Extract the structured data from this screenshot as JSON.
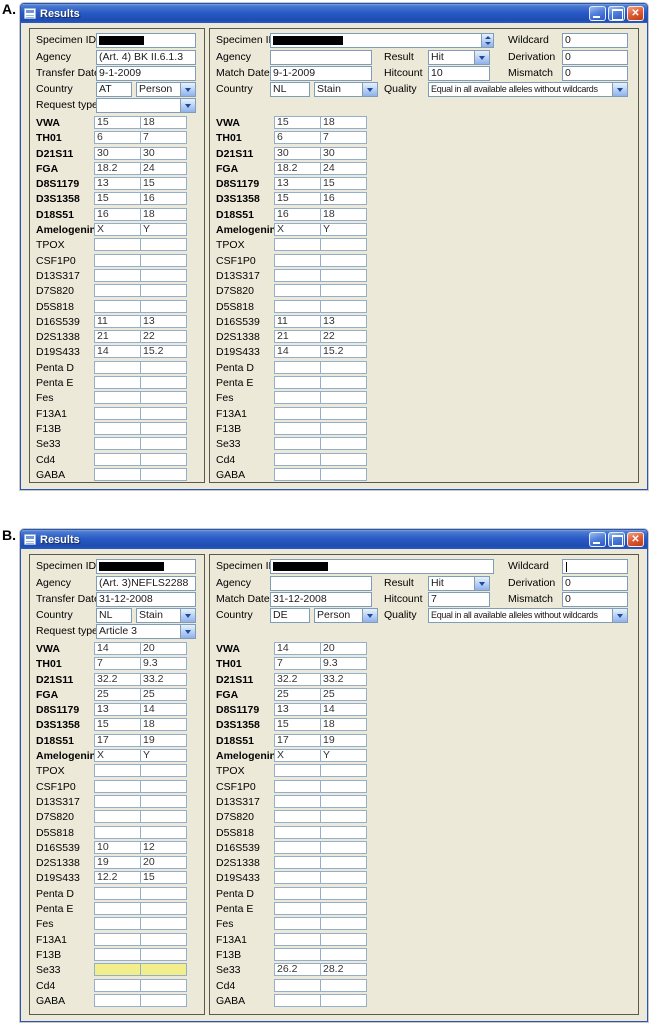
{
  "figure_labels": {
    "a": "A.",
    "b": "B."
  },
  "colors": {
    "titlebar_blue_top": "#7ba2e0",
    "titlebar_blue": "#2a5ac6",
    "title_text": "#ffffff",
    "window_bg": "#ece9d8",
    "groupbox_border": "#5a5a4c",
    "input_border": "#7f9db9",
    "loci_cell_border": "#94aecc",
    "highlight_yellow": "#f2ee8c",
    "close_button_red": "#e06038"
  },
  "icons": [
    "form-icon",
    "minimize-icon",
    "maximize-icon",
    "close-icon",
    "dropdown-arrow-icon",
    "spinner-up-down-icon"
  ],
  "loci": {
    "bold_count": 8,
    "names": [
      "VWA",
      "TH01",
      "D21S11",
      "FGA",
      "D8S1179",
      "D3S1358",
      "D18S51",
      "Amelogenin",
      "TPOX",
      "CSF1P0",
      "D13S317",
      "D7S820",
      "D5S818",
      "D16S539",
      "D2S1338",
      "D19S433",
      "Penta D",
      "Penta E",
      "Fes",
      "F13A1",
      "F13B",
      "Se33",
      "Cd4",
      "GABA"
    ]
  },
  "windows": [
    {
      "outer_label": "A.",
      "title": "Results",
      "left": {
        "labels": {
          "specimen": "Specimen ID",
          "agency": "Agency",
          "date": "Transfer Date",
          "country": "Country",
          "request": "Request type"
        },
        "specimen_redacted_width": 45,
        "agency": "(Art. 4) BK II.6.1.3",
        "date": "9-1-2009",
        "country_code": "AT",
        "country_type": "Person",
        "request_type": "",
        "highlighted_locus": "",
        "loci": [
          [
            "15",
            "18"
          ],
          [
            "6",
            "7"
          ],
          [
            "30",
            "30"
          ],
          [
            "18.2",
            "24"
          ],
          [
            "13",
            "15"
          ],
          [
            "15",
            "16"
          ],
          [
            "16",
            "18"
          ],
          [
            "X",
            "Y"
          ],
          [
            "",
            ""
          ],
          [
            "",
            ""
          ],
          [
            "",
            ""
          ],
          [
            "",
            ""
          ],
          [
            "",
            ""
          ],
          [
            "11",
            "13"
          ],
          [
            "21",
            "22"
          ],
          [
            "14",
            "15.2"
          ],
          [
            "",
            ""
          ],
          [
            "",
            ""
          ],
          [
            "",
            ""
          ],
          [
            "",
            ""
          ],
          [
            "",
            ""
          ],
          [
            "",
            ""
          ],
          [
            "",
            ""
          ],
          [
            "",
            ""
          ]
        ]
      },
      "right": {
        "labels": {
          "specimen": "Specimen ID",
          "agency": "Agency",
          "date": "Match Date",
          "country": "Country",
          "result": "Result",
          "hitcount": "Hitcount",
          "quality": "Quality",
          "wildcard": "Wildcard",
          "derivation": "Derivation",
          "mismatch": "Mismatch"
        },
        "specimen_redacted_width": 70,
        "specimen_has_spinner": true,
        "agency": "",
        "date": "9-1-2009",
        "country_code": "NL",
        "country_type": "Stain",
        "result": "Hit",
        "hitcount": "10",
        "quality": "Equal in all available alleles without wildcards",
        "wildcard": "0",
        "wildcard_caret": false,
        "derivation": "0",
        "mismatch": "0",
        "highlighted_locus": "",
        "loci": [
          [
            "15",
            "18"
          ],
          [
            "6",
            "7"
          ],
          [
            "30",
            "30"
          ],
          [
            "18.2",
            "24"
          ],
          [
            "13",
            "15"
          ],
          [
            "15",
            "16"
          ],
          [
            "16",
            "18"
          ],
          [
            "X",
            "Y"
          ],
          [
            "",
            ""
          ],
          [
            "",
            ""
          ],
          [
            "",
            ""
          ],
          [
            "",
            ""
          ],
          [
            "",
            ""
          ],
          [
            "11",
            "13"
          ],
          [
            "21",
            "22"
          ],
          [
            "14",
            "15.2"
          ],
          [
            "",
            ""
          ],
          [
            "",
            ""
          ],
          [
            "",
            ""
          ],
          [
            "",
            ""
          ],
          [
            "",
            ""
          ],
          [
            "",
            ""
          ],
          [
            "",
            ""
          ],
          [
            "",
            ""
          ]
        ]
      }
    },
    {
      "outer_label": "B.",
      "title": "Results",
      "left": {
        "labels": {
          "specimen": "Specimen ID",
          "agency": "Agency",
          "date": "Transfer Date",
          "country": "Country",
          "request": "Request type"
        },
        "specimen_redacted_width": 65,
        "agency": "(Art. 3)NEFLS2288",
        "date": "31-12-2008",
        "country_code": "NL",
        "country_type": "Stain",
        "request_type": "Article 3",
        "highlighted_locus": "Se33",
        "loci": [
          [
            "14",
            "20"
          ],
          [
            "7",
            "9.3"
          ],
          [
            "32.2",
            "33.2"
          ],
          [
            "25",
            "25"
          ],
          [
            "13",
            "14"
          ],
          [
            "15",
            "18"
          ],
          [
            "17",
            "19"
          ],
          [
            "X",
            "Y"
          ],
          [
            "",
            ""
          ],
          [
            "",
            ""
          ],
          [
            "",
            ""
          ],
          [
            "",
            ""
          ],
          [
            "",
            ""
          ],
          [
            "10",
            "12"
          ],
          [
            "19",
            "20"
          ],
          [
            "12.2",
            "15"
          ],
          [
            "",
            ""
          ],
          [
            "",
            ""
          ],
          [
            "",
            ""
          ],
          [
            "",
            ""
          ],
          [
            "",
            ""
          ],
          [
            "",
            ""
          ],
          [
            "",
            ""
          ],
          [
            "",
            ""
          ]
        ]
      },
      "right": {
        "labels": {
          "specimen": "Specimen ID",
          "agency": "Agency",
          "date": "Match Date",
          "country": "Country",
          "result": "Result",
          "hitcount": "Hitcount",
          "quality": "Quality",
          "wildcard": "Wildcard",
          "derivation": "Derivation",
          "mismatch": "Mismatch"
        },
        "specimen_redacted_width": 55,
        "specimen_has_spinner": false,
        "agency": "",
        "date": "31-12-2008",
        "country_code": "DE",
        "country_type": "Person",
        "result": "Hit",
        "hitcount": "7",
        "quality": "Equal in all available alleles without wildcards",
        "wildcard": "",
        "wildcard_caret": true,
        "derivation": "0",
        "mismatch": "0",
        "highlighted_locus": "",
        "loci": [
          [
            "14",
            "20"
          ],
          [
            "7",
            "9.3"
          ],
          [
            "32.2",
            "33.2"
          ],
          [
            "25",
            "25"
          ],
          [
            "13",
            "14"
          ],
          [
            "15",
            "18"
          ],
          [
            "17",
            "19"
          ],
          [
            "X",
            "Y"
          ],
          [
            "",
            ""
          ],
          [
            "",
            ""
          ],
          [
            "",
            ""
          ],
          [
            "",
            ""
          ],
          [
            "",
            ""
          ],
          [
            "",
            ""
          ],
          [
            "",
            ""
          ],
          [
            "",
            ""
          ],
          [
            "",
            ""
          ],
          [
            "",
            ""
          ],
          [
            "",
            ""
          ],
          [
            "",
            ""
          ],
          [
            "",
            ""
          ],
          [
            "26.2",
            "28.2"
          ],
          [
            "",
            ""
          ],
          [
            "",
            ""
          ]
        ]
      }
    }
  ]
}
